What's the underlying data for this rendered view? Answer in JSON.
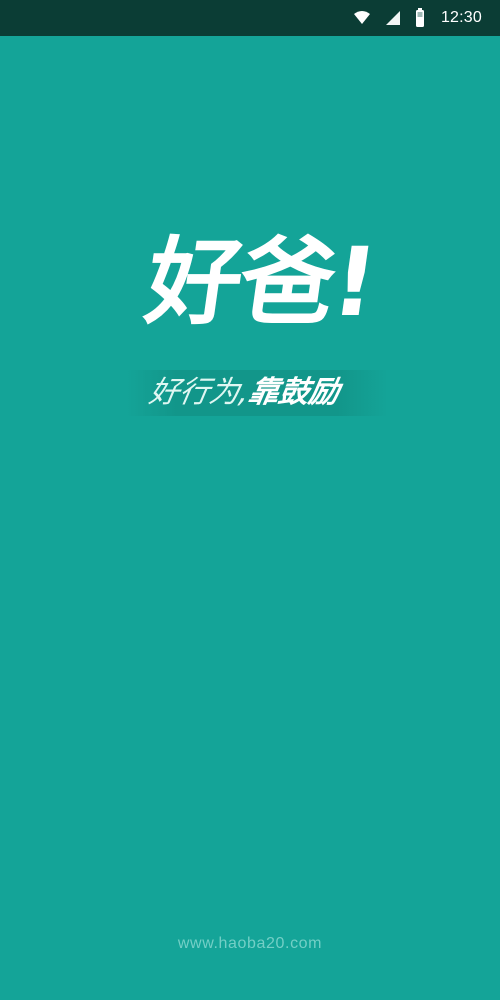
{
  "status_bar": {
    "time": "12:30",
    "icons": [
      "wifi-icon",
      "cell-signal-icon",
      "battery-icon"
    ]
  },
  "splash": {
    "title": "好爸!",
    "slogan_part1": "好行为,",
    "slogan_part2": "靠鼓励",
    "footer_url": "www.haoba20.com"
  },
  "colors": {
    "background": "#14a498",
    "status_bar": "#0b3d35",
    "text": "#ffffff",
    "footer": "#73cfc6"
  }
}
